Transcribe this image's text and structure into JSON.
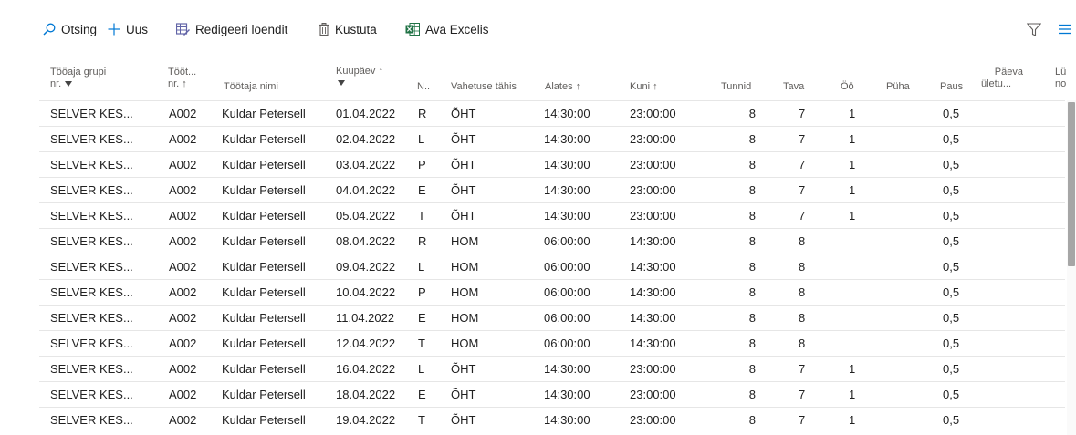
{
  "toolbar": {
    "search_label": "Otsing",
    "new_label": "Uus",
    "edit_list_label": "Redigeeri loendit",
    "delete_label": "Kustuta",
    "excel_label": "Ava Excelis",
    "filter_icon": "filter-icon",
    "list_icon": "list-view-icon"
  },
  "columns": {
    "group_no_l1": "Tööaja grupi",
    "group_no_l2": "nr.",
    "emp_no_l1": "Tööt...",
    "emp_no_l2": "nr. ↑",
    "emp_name": "Töötaja nimi",
    "date": "Kuupäev ↑",
    "day": "N..",
    "shift": "Vahetuse tähis",
    "from": "Alates ↑",
    "to": "Kuni ↑",
    "hours": "Tunnid",
    "normal": "Tava",
    "night": "Öö",
    "holiday": "Püha",
    "pause": "Paus",
    "overtime_l1": "Päeva",
    "overtime_l2": "ületu...",
    "short_l1": "Lühe",
    "short_l2": "norm"
  },
  "rows": [
    {
      "group": "SELVER KES...",
      "emp": "A002",
      "name": "Kuldar Petersell",
      "date": "01.04.2022",
      "day": "R",
      "shift": "ÕHT",
      "from": "14:30:00",
      "to": "23:00:00",
      "hours": "8",
      "normal": "7",
      "night": "1",
      "pause": "0,5"
    },
    {
      "group": "SELVER KES...",
      "emp": "A002",
      "name": "Kuldar Petersell",
      "date": "02.04.2022",
      "day": "L",
      "shift": "ÕHT",
      "from": "14:30:00",
      "to": "23:00:00",
      "hours": "8",
      "normal": "7",
      "night": "1",
      "pause": "0,5"
    },
    {
      "group": "SELVER KES...",
      "emp": "A002",
      "name": "Kuldar Petersell",
      "date": "03.04.2022",
      "day": "P",
      "shift": "ÕHT",
      "from": "14:30:00",
      "to": "23:00:00",
      "hours": "8",
      "normal": "7",
      "night": "1",
      "pause": "0,5"
    },
    {
      "group": "SELVER KES...",
      "emp": "A002",
      "name": "Kuldar Petersell",
      "date": "04.04.2022",
      "day": "E",
      "shift": "ÕHT",
      "from": "14:30:00",
      "to": "23:00:00",
      "hours": "8",
      "normal": "7",
      "night": "1",
      "pause": "0,5"
    },
    {
      "group": "SELVER KES...",
      "emp": "A002",
      "name": "Kuldar Petersell",
      "date": "05.04.2022",
      "day": "T",
      "shift": "ÕHT",
      "from": "14:30:00",
      "to": "23:00:00",
      "hours": "8",
      "normal": "7",
      "night": "1",
      "pause": "0,5"
    },
    {
      "group": "SELVER KES...",
      "emp": "A002",
      "name": "Kuldar Petersell",
      "date": "08.04.2022",
      "day": "R",
      "shift": "HOM",
      "from": "06:00:00",
      "to": "14:30:00",
      "hours": "8",
      "normal": "8",
      "night": "",
      "pause": "0,5"
    },
    {
      "group": "SELVER KES...",
      "emp": "A002",
      "name": "Kuldar Petersell",
      "date": "09.04.2022",
      "day": "L",
      "shift": "HOM",
      "from": "06:00:00",
      "to": "14:30:00",
      "hours": "8",
      "normal": "8",
      "night": "",
      "pause": "0,5"
    },
    {
      "group": "SELVER KES...",
      "emp": "A002",
      "name": "Kuldar Petersell",
      "date": "10.04.2022",
      "day": "P",
      "shift": "HOM",
      "from": "06:00:00",
      "to": "14:30:00",
      "hours": "8",
      "normal": "8",
      "night": "",
      "pause": "0,5"
    },
    {
      "group": "SELVER KES...",
      "emp": "A002",
      "name": "Kuldar Petersell",
      "date": "11.04.2022",
      "day": "E",
      "shift": "HOM",
      "from": "06:00:00",
      "to": "14:30:00",
      "hours": "8",
      "normal": "8",
      "night": "",
      "pause": "0,5"
    },
    {
      "group": "SELVER KES...",
      "emp": "A002",
      "name": "Kuldar Petersell",
      "date": "12.04.2022",
      "day": "T",
      "shift": "HOM",
      "from": "06:00:00",
      "to": "14:30:00",
      "hours": "8",
      "normal": "8",
      "night": "",
      "pause": "0,5"
    },
    {
      "group": "SELVER KES...",
      "emp": "A002",
      "name": "Kuldar Petersell",
      "date": "16.04.2022",
      "day": "L",
      "shift": "ÕHT",
      "from": "14:30:00",
      "to": "23:00:00",
      "hours": "8",
      "normal": "7",
      "night": "1",
      "pause": "0,5"
    },
    {
      "group": "SELVER KES...",
      "emp": "A002",
      "name": "Kuldar Petersell",
      "date": "18.04.2022",
      "day": "E",
      "shift": "ÕHT",
      "from": "14:30:00",
      "to": "23:00:00",
      "hours": "8",
      "normal": "7",
      "night": "1",
      "pause": "0,5"
    },
    {
      "group": "SELVER KES...",
      "emp": "A002",
      "name": "Kuldar Petersell",
      "date": "19.04.2022",
      "day": "T",
      "shift": "ÕHT",
      "from": "14:30:00",
      "to": "23:00:00",
      "hours": "8",
      "normal": "7",
      "night": "1",
      "pause": "0,5"
    }
  ],
  "colors": {
    "accent": "#0078d4",
    "edit_icon": "#6264a7",
    "excel_icon": "#217346"
  }
}
